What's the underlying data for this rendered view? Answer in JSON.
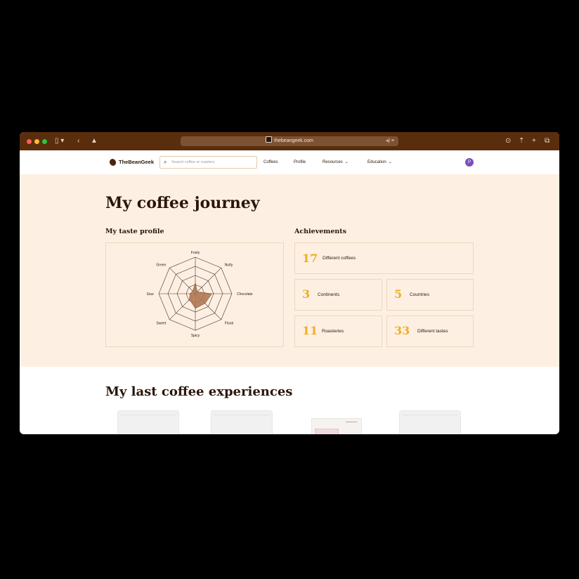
{
  "browser": {
    "url": "thebeangeek.com",
    "colors": {
      "chrome": "#5a2d0c",
      "urlbar": "#7d5233"
    }
  },
  "nav": {
    "logo_text": "TheBeanGeek",
    "search_placeholder": "Search coffee or roastery",
    "links": [
      {
        "label": "Coffees"
      },
      {
        "label": "Profile"
      },
      {
        "label": "Resources"
      },
      {
        "label": "Education"
      }
    ],
    "avatar_initial": "P"
  },
  "hero": {
    "title": "My coffee journey",
    "taste_profile_heading": "My taste profile",
    "achievements_heading": "Achievements",
    "background_color": "#fdf0e3",
    "accent_color": "#f0ac25"
  },
  "taste_profile": {
    "type": "radar",
    "axes": [
      "Fruity",
      "Nutty",
      "Chocolate",
      "Floral",
      "Spicy",
      "Sweet",
      "Sour",
      "Green"
    ],
    "values": [
      1.2,
      0.3,
      1.8,
      1.5,
      1.6,
      0.9,
      0.6,
      0.4
    ],
    "max": 4,
    "fill_color": "#b07852"
  },
  "achievements": [
    {
      "value": "17",
      "label": "Different coffees"
    },
    {
      "value": "3",
      "label": "Continents"
    },
    {
      "value": "5",
      "label": "Countries"
    },
    {
      "value": "11",
      "label": "Roasteries"
    },
    {
      "value": "33",
      "label": "Different tastes"
    }
  ],
  "experiences": {
    "title": "My last coffee experiences"
  }
}
